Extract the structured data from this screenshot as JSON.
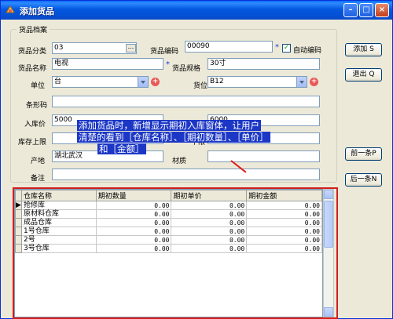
{
  "window": {
    "title": "添加货品",
    "minimize_glyph": "–",
    "maximize_glyph": "□",
    "close_glyph": "×"
  },
  "form": {
    "group_title": "货品档案",
    "category": {
      "label": "货品分类",
      "value": "03",
      "browse": "..."
    },
    "code": {
      "label": "货品编码",
      "value": "00090",
      "required": "*"
    },
    "auto_code": {
      "label": "自动编码",
      "checked": true,
      "check_glyph": "✓"
    },
    "name": {
      "label": "货品名称",
      "value": "电视",
      "required": "*"
    },
    "spec": {
      "label": "货品规格",
      "value": "30寸"
    },
    "unit": {
      "label": "单位",
      "value": "台"
    },
    "location": {
      "label": "货位",
      "value": "B12"
    },
    "barcode": {
      "label": "条形码",
      "value": ""
    },
    "purchase_price": {
      "label": "入库价",
      "value": "5000"
    },
    "sale_price": {
      "value": "6000"
    },
    "stock_upper": {
      "label": "库存上限",
      "value": ""
    },
    "stock_lower": {
      "label": "下限",
      "value": ""
    },
    "origin": {
      "label": "产地",
      "value": "湖北武汉"
    },
    "material": {
      "label": "材质",
      "value": ""
    },
    "remark": {
      "label": "备注",
      "value": ""
    }
  },
  "buttons": {
    "add": "添加 S",
    "exit": "退出 Q",
    "prev": "前一条P",
    "next": "后一条N"
  },
  "grid": {
    "columns": [
      "仓库名称",
      "期初数量",
      "期初单价",
      "期初金额"
    ],
    "rows": [
      [
        "抢修库",
        "0.00",
        "0.00",
        "0.00"
      ],
      [
        "原材料仓库",
        "0.00",
        "0.00",
        "0.00"
      ],
      [
        "成品仓库",
        "0.00",
        "0.00",
        "0.00"
      ],
      [
        "1号仓库",
        "0.00",
        "0.00",
        "0.00"
      ],
      [
        "2号",
        "0.00",
        "0.00",
        "0.00"
      ],
      [
        "3号仓库",
        "0.00",
        "0.00",
        "0.00"
      ]
    ],
    "current_row_indicator": "▶"
  },
  "annotation": {
    "line1": "添加货品时，新增显示期初入库窗体，让用户",
    "line2": "清楚的看到［仓库名称］、［期初数量］、［单价］",
    "line3": "和［金额］"
  },
  "colors": {
    "title_bar": "#0558e0",
    "annotation_highlight": "#1c37c6",
    "emphasis_border": "#d21d1d"
  }
}
